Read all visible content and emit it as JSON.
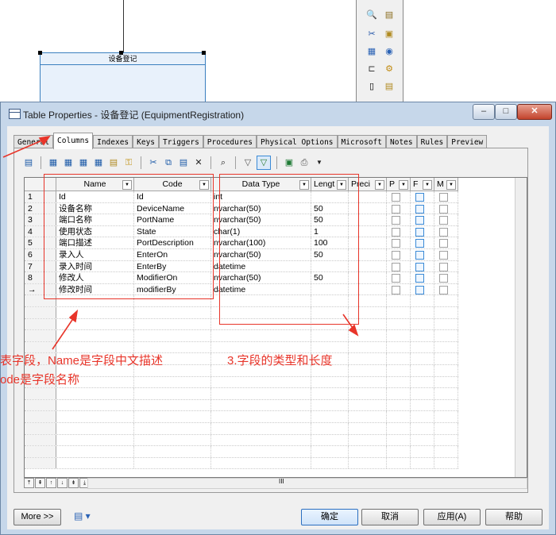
{
  "background": {
    "entity_title": "设备登记"
  },
  "window": {
    "title": "Table Properties - 设备登记 (EquipmentRegistration)",
    "controls": {
      "minimize": "–",
      "maximize": "□",
      "close": "✕"
    }
  },
  "tabs": [
    "General",
    "Columns",
    "Indexes",
    "Keys",
    "Triggers",
    "Procedures",
    "Physical Options",
    "Microsoft",
    "Notes",
    "Rules",
    "Preview"
  ],
  "active_tab": "Columns",
  "grid": {
    "headers": [
      "Name",
      "Code",
      "Data Type",
      "Lengt",
      "Preci",
      "P",
      "F",
      "M"
    ],
    "rows": [
      {
        "num": "1",
        "name": "Id",
        "code": "Id",
        "type": "int",
        "length": ""
      },
      {
        "num": "2",
        "name": "设备名称",
        "code": "DeviceName",
        "type": "nvarchar(50)",
        "length": "50"
      },
      {
        "num": "3",
        "name": "端口名称",
        "code": "PortName",
        "type": "nvarchar(50)",
        "length": "50"
      },
      {
        "num": "4",
        "name": "使用状态",
        "code": "State",
        "type": "char(1)",
        "length": "1"
      },
      {
        "num": "5",
        "name": "端口描述",
        "code": "PortDescription",
        "type": "nvarchar(100)",
        "length": "100"
      },
      {
        "num": "6",
        "name": "录入人",
        "code": "EnterOn",
        "type": "nvarchar(50)",
        "length": "50"
      },
      {
        "num": "7",
        "name": "录入时间",
        "code": "EnterBy",
        "type": "datetime",
        "length": ""
      },
      {
        "num": "8",
        "name": "修改人",
        "code": "ModifierOn",
        "type": "nvarchar(50)",
        "length": "50"
      },
      {
        "num": "→",
        "name": "修改时间",
        "code": "modifierBy",
        "type": "datetime",
        "length": ""
      }
    ],
    "scroll_marker": "III"
  },
  "buttons": {
    "more": "More >>",
    "ok": "确定",
    "cancel": "取消",
    "apply": "应用(A)",
    "help": "帮助"
  },
  "annotations": {
    "left_line1": "表字段，Name是字段中文描述",
    "left_line2": "ode是字段名称",
    "right": "3.字段的类型和长度"
  },
  "colors": {
    "annotation": "#e8352a",
    "window_frame": "#c6d7ea",
    "checkbox_blue": "#3b8ad6"
  }
}
